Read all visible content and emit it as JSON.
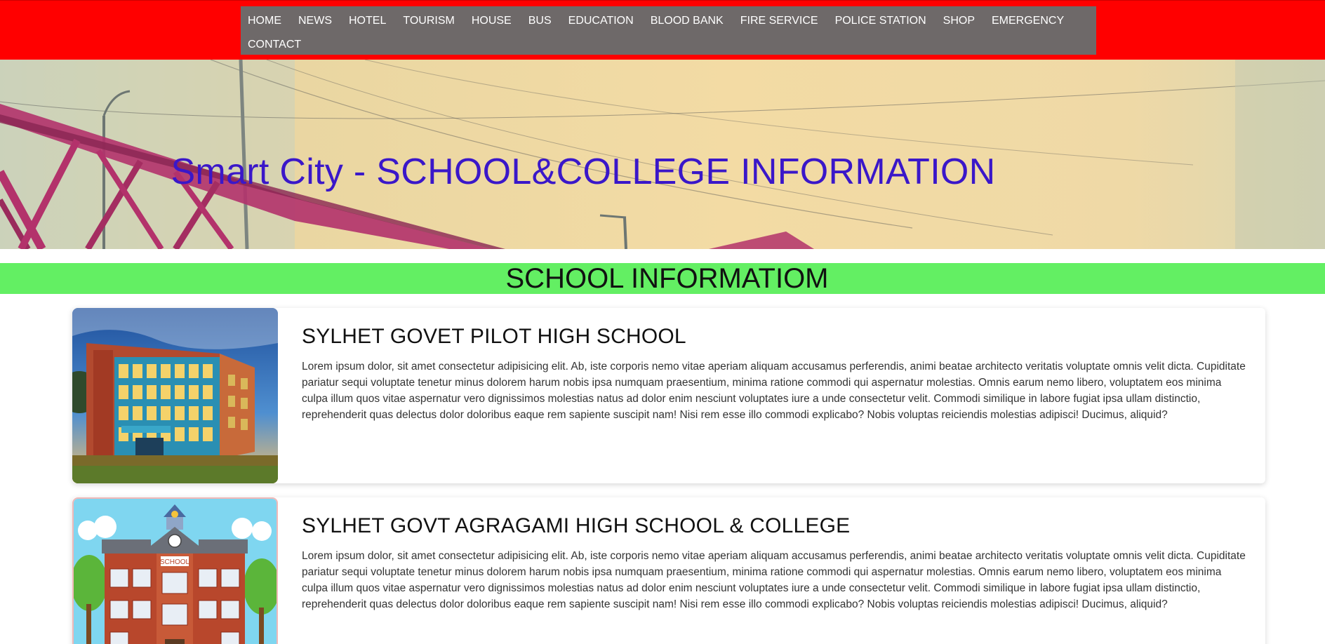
{
  "nav": {
    "items": [
      "HOME",
      "NEWS",
      "HOTEL",
      "TOURISM",
      "HOUSE",
      "BUS",
      "EDUCATION",
      "BLOOD BANK",
      "FIRE SERVICE",
      "POLICE STATION",
      "SHOP",
      "EMERGENCY",
      "CONTACT"
    ]
  },
  "hero": {
    "title": "Smart City - SCHOOL&COLLEGE INFORMATION"
  },
  "section": {
    "title": "SCHOOL INFORMATIOM"
  },
  "cards": [
    {
      "title": "SYLHET GOVET PILOT HIGH SCHOOL",
      "text": "Lorem ipsum dolor, sit amet consectetur adipisicing elit. Ab, iste corporis nemo vitae aperiam aliquam accusamus perferendis, animi beatae architecto veritatis voluptate omnis velit dicta. Cupiditate pariatur sequi voluptate tenetur minus dolorem harum nobis ipsa numquam praesentium, minima ratione commodi qui aspernatur molestias. Omnis earum nemo libero, voluptatem eos minima culpa illum quos vitae aspernatur vero dignissimos molestias natus ad dolor enim nesciunt voluptates iure a unde consectetur velit. Commodi similique in labore fugiat ipsa ullam distinctio, reprehenderit quas delectus dolor doloribus eaque rem sapiente suscipit nam! Nisi rem esse illo commodi explicabo? Nobis voluptas reiciendis molestias adipisci! Ducimus, aliquid?"
    },
    {
      "title": "SYLHET GOVT AGRAGAMI HIGH SCHOOL & COLLEGE",
      "text": "Lorem ipsum dolor, sit amet consectetur adipisicing elit. Ab, iste corporis nemo vitae aperiam aliquam accusamus perferendis, animi beatae architecto veritatis voluptate omnis velit dicta. Cupiditate pariatur sequi voluptate tenetur minus dolorem harum nobis ipsa numquam praesentium, minima ratione commodi qui aspernatur molestias. Omnis earum nemo libero, voluptatem eos minima culpa illum quos vitae aspernatur vero dignissimos molestias natus ad dolor enim nesciunt voluptates iure a unde consectetur velit. Commodi similique in labore fugiat ipsa ullam distinctio, reprehenderit quas delectus dolor doloribus eaque rem sapiente suscipit nam! Nisi rem esse illo commodi explicabo? Nobis voluptas reiciendis molestias adipisci! Ducimus, aliquid?",
      "image_sign": "SCHOOL"
    }
  ],
  "colors": {
    "topbar": "#ff0000",
    "nav_bg": "#6e6969",
    "hero_title": "#3a17c9",
    "section_bar": "#63ef63"
  }
}
